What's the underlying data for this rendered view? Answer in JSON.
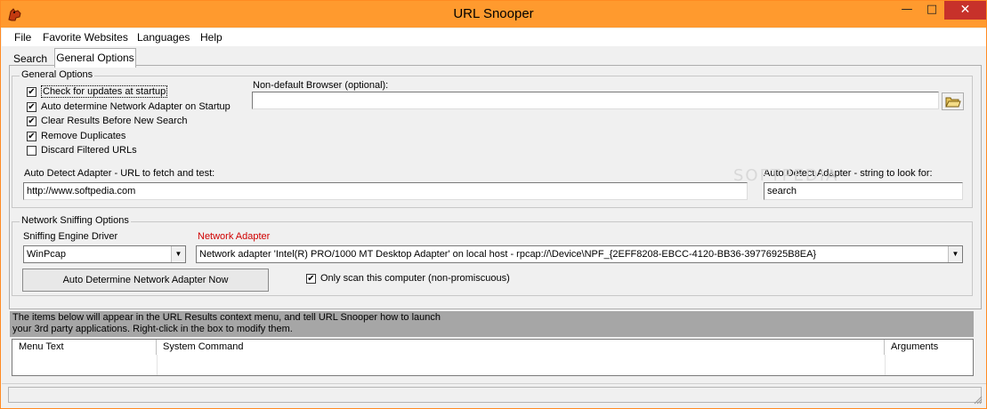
{
  "window": {
    "title": "URL Snooper",
    "icon": "dog-app-icon",
    "controls": {
      "minimize": "—",
      "maximize": "□",
      "close": "✕"
    },
    "accent_color": "#ff9a2e"
  },
  "menu": [
    "File",
    "Favorite Websites",
    "Languages",
    "Help"
  ],
  "tabs": [
    {
      "label": "Search",
      "active": false
    },
    {
      "label": "General Options",
      "active": true
    }
  ],
  "general_options": {
    "legend": "General Options",
    "checkboxes": [
      {
        "label": "Check for updates at startup",
        "checked": true,
        "mark": "✔"
      },
      {
        "label": "Auto determine Network Adapter on Startup",
        "checked": true,
        "mark": "✔"
      },
      {
        "label": "Clear Results Before New Search",
        "checked": true,
        "mark": "✔"
      },
      {
        "label": "Remove Duplicates",
        "checked": true,
        "mark": "✔"
      },
      {
        "label": "Discard Filtered URLs",
        "checked": false,
        "mark": ""
      }
    ],
    "browser_label": "Non-default Browser (optional):",
    "browser_value": "",
    "url_label": "Auto Detect Adapter - URL to fetch and test:",
    "url_value": "http://www.softpedia.com",
    "string_label": "Auto Detect Adapter - string to look for:",
    "string_value": "search"
  },
  "network_options": {
    "legend": "Network Sniffing Options",
    "driver_label": "Sniffing Engine Driver",
    "driver_value": "WinPcap",
    "adapter_label": "Network Adapter",
    "adapter_color": "#d00000",
    "adapter_value": "Network adapter 'Intel(R) PRO/1000 MT Desktop Adapter' on local host - rpcap://\\Device\\NPF_{2EFF8208-EBCC-4120-BB36-39776925B8EA}",
    "auto_button": "Auto Determine Network Adapter Now",
    "only_scan_label": "Only scan this computer (non-promiscuous)",
    "only_scan_checked": true,
    "only_scan_mark": "✔"
  },
  "watermark": "SOFTPEDIA",
  "info_text": {
    "line1": "The items below will appear in the URL Results context menu, and tell URL Snooper how to launch",
    "line2": "your 3rd party applications.  Right-click in the box to modify them."
  },
  "grid": {
    "columns": [
      "Menu Text",
      "System Command",
      "Arguments"
    ],
    "rows": []
  }
}
